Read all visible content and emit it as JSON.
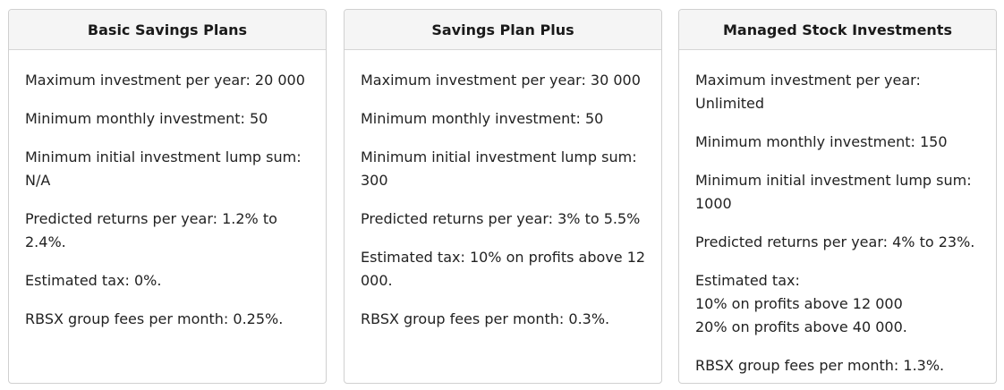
{
  "plans": [
    {
      "title": "Basic Savings Plans",
      "lines": [
        "Maximum investment per year: 20 000",
        "Minimum monthly investment: 50",
        "Minimum initial investment lump sum:\nN/A",
        "Predicted returns per year: 1.2% to 2.4%.",
        "Estimated tax: 0%.",
        "RBSX group fees per month: 0.25%."
      ]
    },
    {
      "title": "Savings Plan Plus",
      "lines": [
        "Maximum investment per year: 30 000",
        "Minimum monthly investment: 50",
        "Minimum initial investment lump sum:\n300",
        "Predicted returns per year: 3% to 5.5%",
        "Estimated tax: 10% on profits above 12\n000.",
        "RBSX group fees per month: 0.3%."
      ]
    },
    {
      "title": "Managed Stock Investments",
      "lines": [
        "Maximum investment per year: Unlimited",
        "Minimum monthly investment: 150",
        "Minimum initial investment lump sum:\n1000",
        "Predicted returns per year: 4% to 23%.",
        "Estimated tax:\n10% on profits above 12 000\n20% on profits above 40 000.",
        "RBSX group fees per month: 1.3%."
      ]
    }
  ]
}
